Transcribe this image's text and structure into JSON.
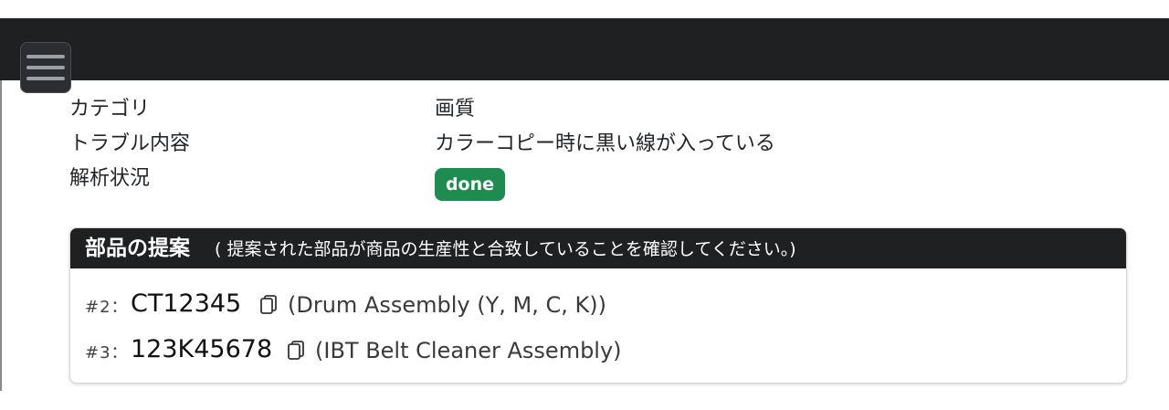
{
  "navbar": {
    "menu_icon": "hamburger-menu-icon"
  },
  "info": {
    "category_label": "カテゴリ",
    "category_value": "画質",
    "trouble_label": "トラブル内容",
    "trouble_value": "カラーコピー時に黒い線が入っている",
    "status_label": "解析状況",
    "status_value": "done",
    "status_color": "#1e8c4e"
  },
  "card": {
    "title": "部品の提案",
    "subtitle": "( 提案された部品が商品の生産性と合致していることを確認してください。)",
    "parts": [
      {
        "num": "#2：",
        "code": "CT12345",
        "copy_icon": "copy-icon",
        "desc": "(Drum Assembly (Y, M, C, K))"
      },
      {
        "num": "#3：",
        "code": "123K45678",
        "copy_icon": "copy-icon",
        "desc": "(IBT Belt Cleaner Assembly)"
      }
    ]
  }
}
